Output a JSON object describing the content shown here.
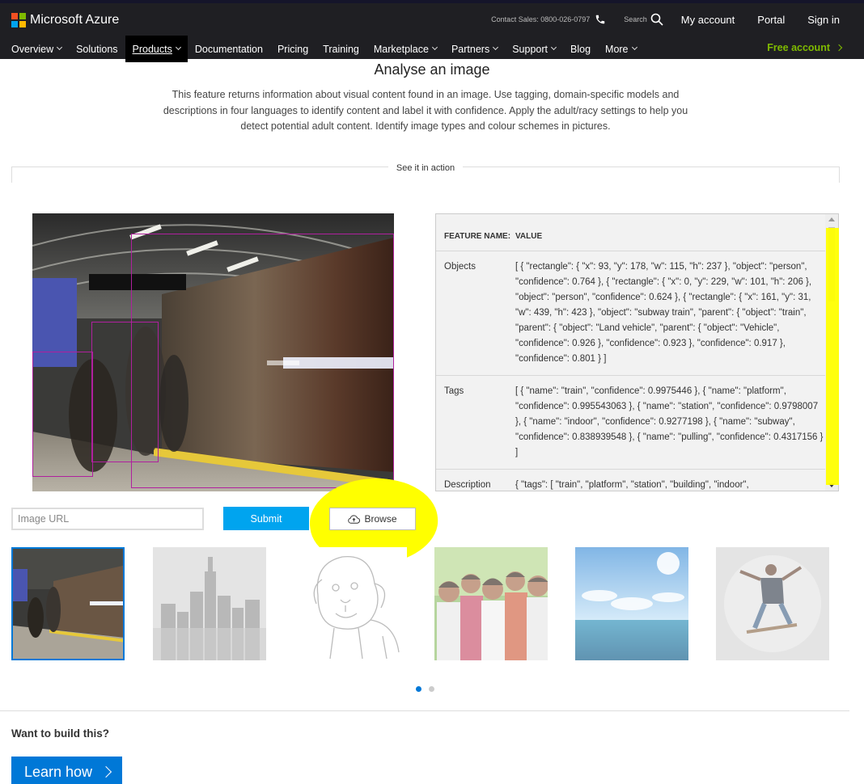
{
  "brand": {
    "name": "Microsoft Azure",
    "logo_colors": [
      "#f25022",
      "#7fba00",
      "#00a4ef",
      "#ffb900"
    ]
  },
  "utility": {
    "contact": "Contact Sales: 0800-026-0797",
    "search_label": "Search",
    "my_account": "My account",
    "portal": "Portal",
    "sign_in": "Sign in"
  },
  "nav": {
    "items": [
      {
        "label": "Overview",
        "dropdown": true
      },
      {
        "label": "Solutions",
        "dropdown": false
      },
      {
        "label": "Products",
        "dropdown": true,
        "active": true
      },
      {
        "label": "Documentation",
        "dropdown": false
      },
      {
        "label": "Pricing",
        "dropdown": false
      },
      {
        "label": "Training",
        "dropdown": false
      },
      {
        "label": "Marketplace",
        "dropdown": true
      },
      {
        "label": "Partners",
        "dropdown": true
      },
      {
        "label": "Support",
        "dropdown": true
      },
      {
        "label": "Blog",
        "dropdown": false
      },
      {
        "label": "More",
        "dropdown": true
      }
    ],
    "free_account": "Free account"
  },
  "page": {
    "title": "Analyse an image",
    "description": "This feature returns information about visual content found in an image. Use tagging, domain-specific models and descriptions in four languages to identify content and label it with confidence. Apply the adult/racy settings to help you detect potential adult content. Identify image types and colour schemes in pictures.",
    "see_it_in_action": "See it in action"
  },
  "results": {
    "header_feature": "FEATURE NAME:",
    "header_value": "VALUE",
    "rows": [
      {
        "name": "Objects",
        "value": "[ { \"rectangle\": { \"x\": 93, \"y\": 178, \"w\": 115, \"h\": 237 }, \"object\": \"person\", \"confidence\": 0.764 }, { \"rectangle\": { \"x\": 0, \"y\": 229, \"w\": 101, \"h\": 206 }, \"object\": \"person\", \"confidence\": 0.624 }, { \"rectangle\": { \"x\": 161, \"y\": 31, \"w\": 439, \"h\": 423 }, \"object\": \"subway train\", \"parent\": { \"object\": \"train\", \"parent\": { \"object\": \"Land vehicle\", \"parent\": { \"object\": \"Vehicle\", \"confidence\": 0.926 }, \"confidence\": 0.923 }, \"confidence\": 0.917 }, \"confidence\": 0.801 } ]"
      },
      {
        "name": "Tags",
        "value": "[ { \"name\": \"train\", \"confidence\": 0.9975446 }, { \"name\": \"platform\", \"confidence\": 0.995543063 }, { \"name\": \"station\", \"confidence\": 0.9798007 }, { \"name\": \"indoor\", \"confidence\": 0.9277198 }, { \"name\": \"subway\", \"confidence\": 0.838939548 }, { \"name\": \"pulling\", \"confidence\": 0.4317156 } ]"
      },
      {
        "name": "Description",
        "value": "{ \"tags\": [ \"train\", \"platform\", \"station\", \"building\", \"indoor\","
      }
    ]
  },
  "controls": {
    "url_placeholder": "Image URL",
    "submit": "Submit",
    "browse": "Browse"
  },
  "thumbnails": [
    {
      "name": "subway-train",
      "selected": true
    },
    {
      "name": "city-skyline",
      "selected": false
    },
    {
      "name": "lion-drawing",
      "selected": false
    },
    {
      "name": "family-group",
      "selected": false
    },
    {
      "name": "ocean-sky",
      "selected": false
    },
    {
      "name": "skateboarder",
      "selected": false
    }
  ],
  "carousel": {
    "pages": 2,
    "active": 1
  },
  "footer": {
    "build_heading": "Want to build this?",
    "learn_how": "Learn how"
  },
  "colors": {
    "header_bg": "#1f1f23",
    "accent_blue": "#0078d7",
    "submit_blue": "#00a4ef",
    "free_green": "#7fba00",
    "bbox_magenta": "#b0209e",
    "highlight_yellow": "#ffff00"
  }
}
